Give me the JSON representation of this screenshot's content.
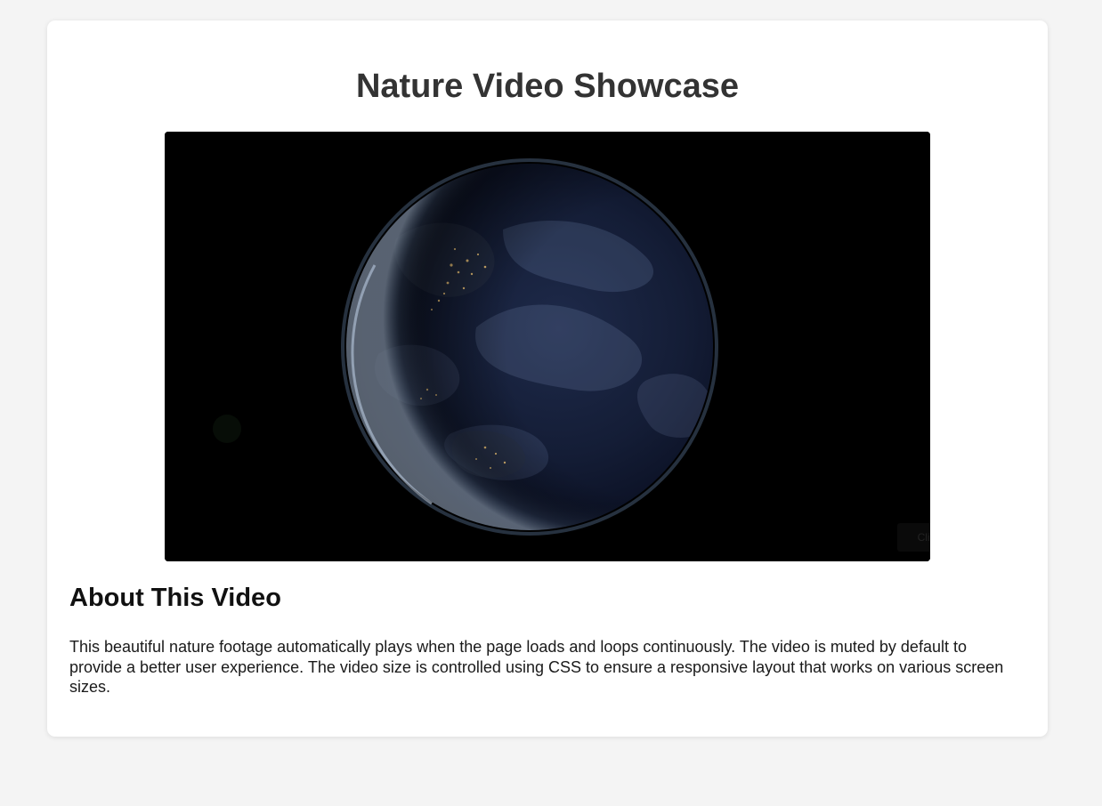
{
  "page": {
    "title": "Nature Video Showcase",
    "background_color": "#f4f4f4",
    "card_color": "#ffffff"
  },
  "video": {
    "subject": "earth-at-night-from-space",
    "autoplay": true,
    "loop": true,
    "muted": true,
    "watermark_text": "Click to watch in full screen"
  },
  "about": {
    "heading": "About This Video",
    "body": "This beautiful nature footage automatically plays when the page loads and loops continuously. The video is muted by default to provide a better user experience. The video size is controlled using CSS to ensure a responsive layout that works on various screen sizes."
  }
}
